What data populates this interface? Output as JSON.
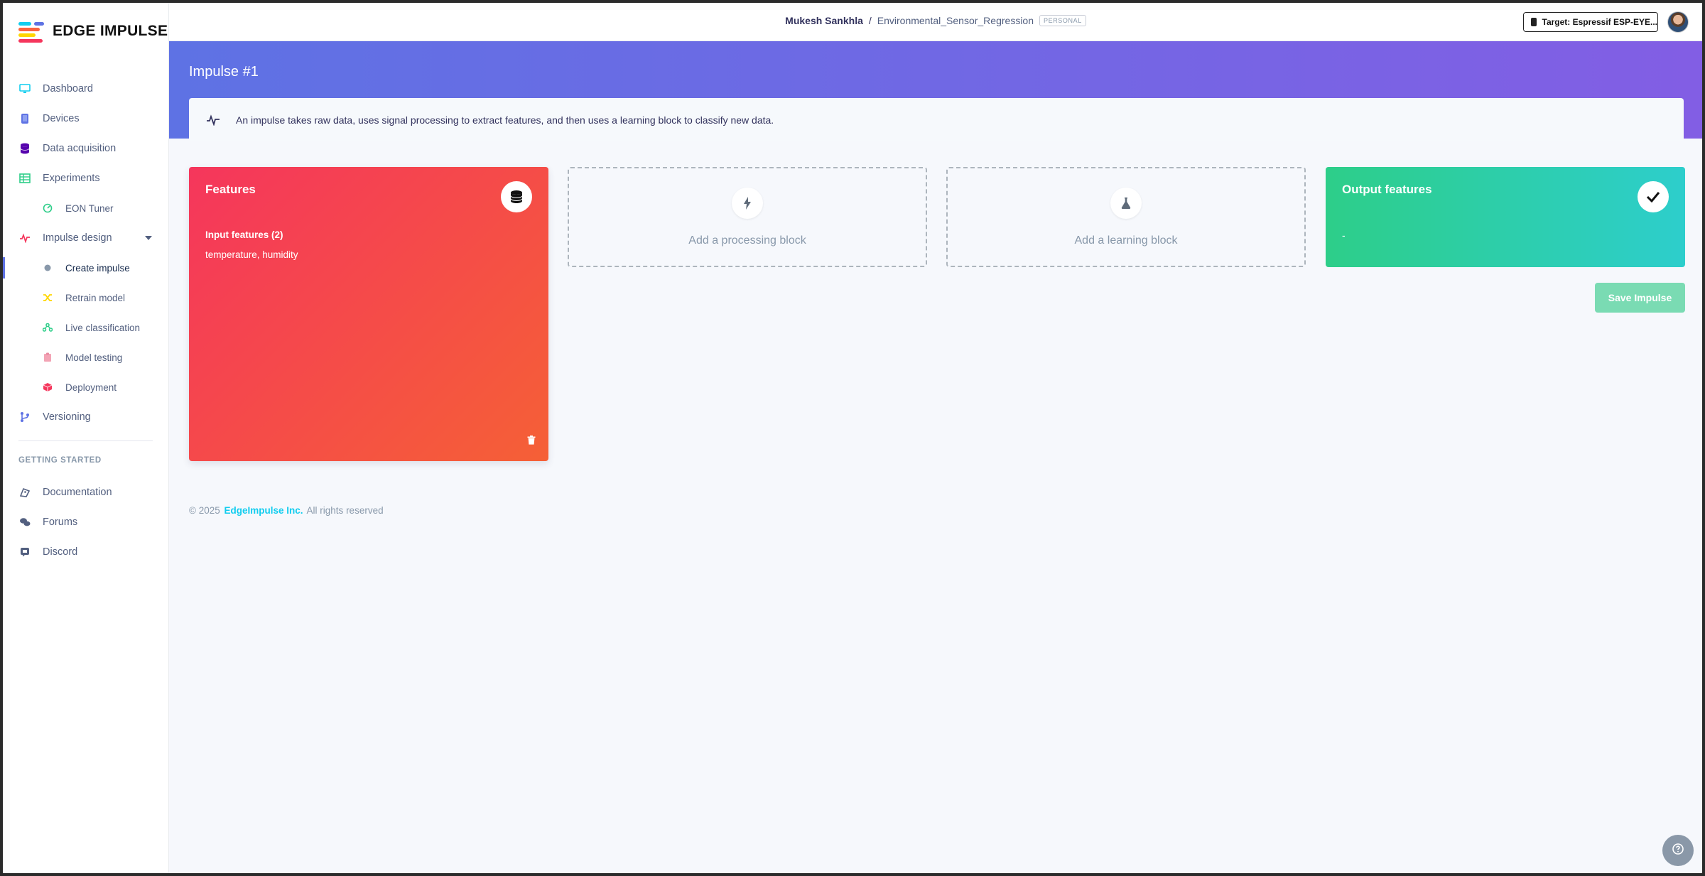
{
  "app": {
    "logo_text": "EDGE IMPULSE"
  },
  "sidebar": {
    "items": [
      {
        "label": "Dashboard",
        "icon": "monitor-icon",
        "color": "#11cdef"
      },
      {
        "label": "Devices",
        "icon": "device-icon",
        "color": "#5e72e4"
      },
      {
        "label": "Data acquisition",
        "icon": "database-icon",
        "color": "#5603ad"
      },
      {
        "label": "Experiments",
        "icon": "table-icon",
        "color": "#2dce89"
      },
      {
        "label": "EON Tuner",
        "icon": "tuner-icon",
        "color": "#2dce89"
      },
      {
        "label": "Impulse design",
        "icon": "pulse-icon",
        "color": "#f5365c"
      },
      {
        "label": "Create impulse",
        "icon": "dot-icon",
        "color": "#8898aa"
      },
      {
        "label": "Retrain model",
        "icon": "shuffle-icon",
        "color": "#ffd600"
      },
      {
        "label": "Live classification",
        "icon": "nodes-icon",
        "color": "#2dce89"
      },
      {
        "label": "Model testing",
        "icon": "clipboard-icon",
        "color": "#f3a4b5"
      },
      {
        "label": "Deployment",
        "icon": "cube-icon",
        "color": "#f5365c"
      },
      {
        "label": "Versioning",
        "icon": "branch-icon",
        "color": "#5e72e4"
      }
    ],
    "getting_started_label": "GETTING STARTED",
    "help_items": [
      {
        "label": "Documentation",
        "icon": "docs-icon"
      },
      {
        "label": "Forums",
        "icon": "forums-icon"
      },
      {
        "label": "Discord",
        "icon": "discord-icon"
      }
    ]
  },
  "topbar": {
    "user": "Mukesh Sankhla",
    "separator": "/",
    "project": "Environmental_Sensor_Regression",
    "badge": "PERSONAL",
    "target_label": "Target: Espressif ESP-EYE..."
  },
  "header": {
    "title": "Impulse #1",
    "info_text": "An impulse takes raw data, uses signal processing to extract features, and then uses a learning block to classify new data."
  },
  "blocks": {
    "features": {
      "title": "Features",
      "input_label": "Input features (2)",
      "input_values": "temperature, humidity"
    },
    "processing": {
      "label": "Add a processing block"
    },
    "learning": {
      "label": "Add a learning block"
    },
    "output": {
      "title": "Output features",
      "value": "-"
    }
  },
  "actions": {
    "save_label": "Save Impulse"
  },
  "footer": {
    "copyright": "© 2025",
    "company": "EdgeImpulse Inc.",
    "rights": "All rights reserved"
  },
  "colors": {
    "accent": "#5e72e4",
    "features_gradient_start": "#f5365c",
    "features_gradient_end": "#f56036",
    "output_gradient_start": "#2dce89",
    "output_gradient_end": "#2dcecc"
  }
}
